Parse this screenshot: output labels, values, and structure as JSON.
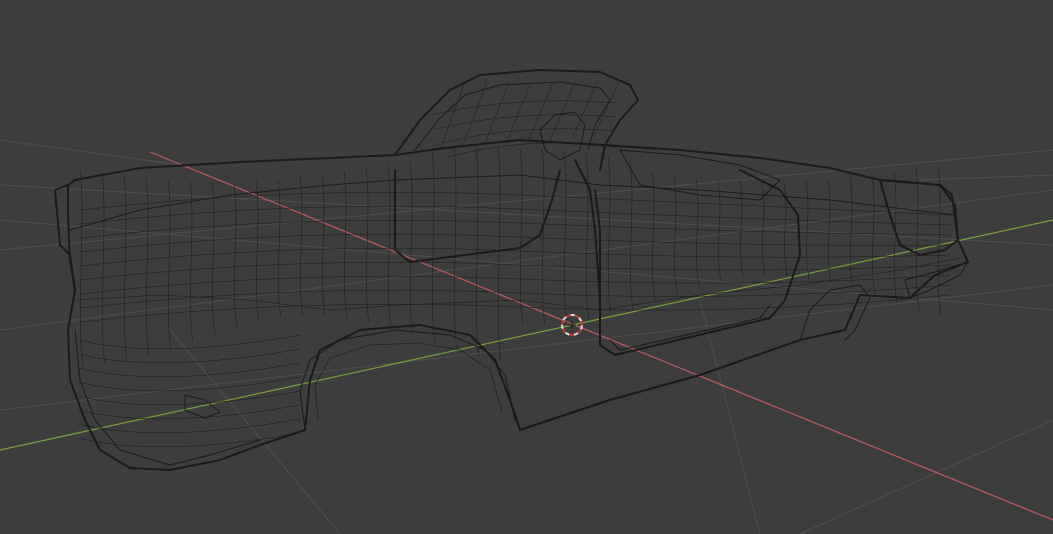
{
  "viewport": {
    "background_color": "#3d3d3d",
    "grid_color": "#4f4f4f",
    "wireframe_color": "#1a1a1a",
    "x_axis_color": "#c05a5f",
    "y_axis_color": "#7aa23a",
    "cursor_color_primary": "#e0e0e0",
    "cursor_color_secondary": "#c0392b"
  },
  "scene": {
    "object_icon": "car-wireframe-model",
    "cursor_icon": "3d-cursor-icon",
    "shading_mode": "wireframe"
  }
}
